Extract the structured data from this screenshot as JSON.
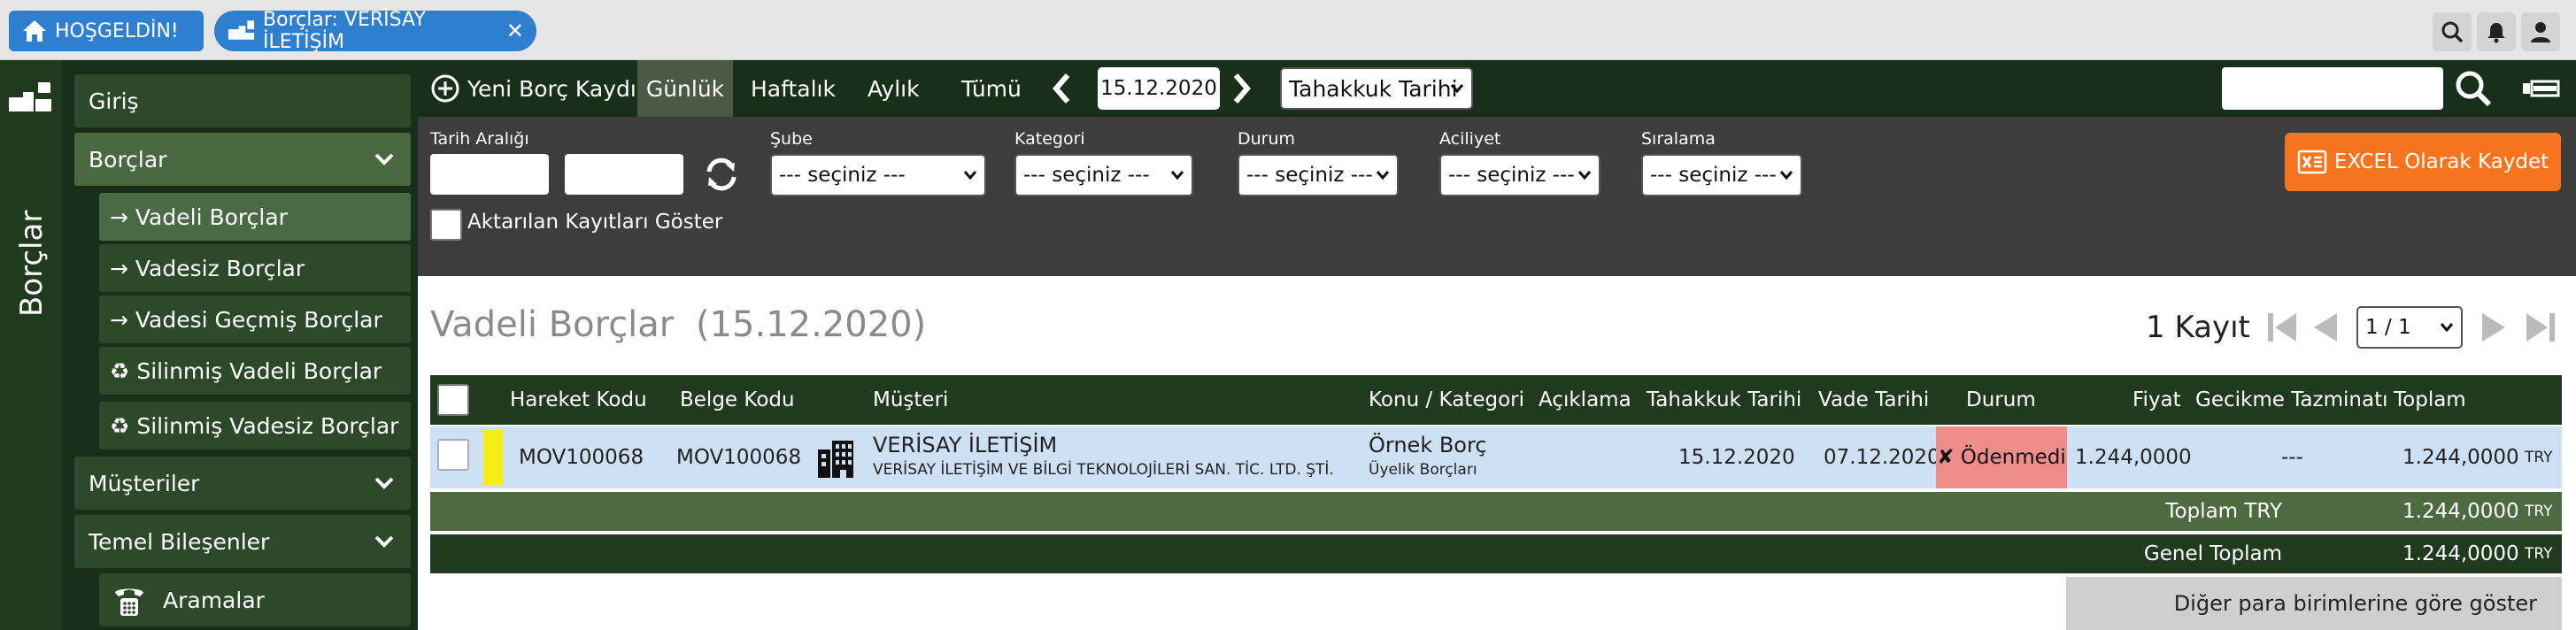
{
  "topbar": {
    "home_tab": "HOŞGELDİN!",
    "active_tab": "Borçlar: VERİSAY İLETİŞİM"
  },
  "rail": {
    "title": "Borçlar"
  },
  "sidebar": {
    "giris": "Giriş",
    "borclar": "Borçlar",
    "vadeli": "→ Vadeli Borçlar",
    "vadesiz": "→ Vadesiz Borçlar",
    "vadesi_gecmis": "→ Vadesi Geçmiş Borçlar",
    "silinmis_vadeli": "♻ Silinmiş Vadeli Borçlar",
    "silinmis_vadesiz": "♻ Silinmiş Vadesiz Borçlar",
    "musteriler": "Müşteriler",
    "temel": "Temel Bileşenler",
    "aramalar": "Aramalar"
  },
  "toolbar": {
    "new_record": "Yeni Borç Kaydı",
    "gunluk": "Günlük",
    "haftalik": "Haftalık",
    "aylik": "Aylık",
    "tumu": "Tümü",
    "date": "15.12.2020",
    "date_type": "Tahakkuk Tarihi"
  },
  "filters": {
    "tarih_araligi": "Tarih Aralığı",
    "sube": "Şube",
    "kategori": "Kategori",
    "durum": "Durum",
    "aciliyet": "Aciliyet",
    "siralama": "Sıralama",
    "placeholder_option": "--- seçiniz ---",
    "aktarilan": "Aktarılan Kayıtları Göster",
    "excel": "EXCEL Olarak Kaydet"
  },
  "content": {
    "title": "Vadeli Borçlar",
    "title_date": "(15.12.2020)",
    "count": "1 Kayıt",
    "page": "1 / 1"
  },
  "table": {
    "headers": {
      "hareket": "Hareket Kodu",
      "belge": "Belge Kodu",
      "musteri": "Müşteri",
      "konu": "Konu / Kategori",
      "aciklama": "Açıklama",
      "tahakkuk": "Tahakkuk Tarihi",
      "vade": "Vade Tarihi",
      "durum": "Durum",
      "fiyat": "Fiyat",
      "gecikme": "Gecikme Tazminatı",
      "toplam": "Toplam"
    },
    "row": {
      "hareket": "MOV100068",
      "belge": "MOV100068",
      "musteri": "VERİSAY İLETİŞİM",
      "musteri_full": "VERİSAY İLETİŞİM VE BİLGİ TEKNOLOJİLERİ SAN. TİC. LTD. ŞTİ.",
      "konu": "Örnek Borç",
      "kategori": "Üyelik Borçları",
      "tahakkuk": "15.12.2020",
      "vade": "07.12.2020",
      "durum": "✘ Ödenmedi",
      "fiyat": "1.244,0000",
      "gecikme": "---",
      "toplam": "1.244,0000",
      "currency": "TRY"
    },
    "sum_try_label": "Toplam TRY",
    "sum_try_value": "1.244,0000",
    "sum_try_currency": "TRY",
    "grand_label": "Genel Toplam",
    "grand_value": "1.244,0000",
    "grand_currency": "TRY",
    "other_currency_btn": "Diğer para birimlerine göre göster"
  },
  "colors": {
    "accent_blue": "#2f7fd1",
    "dark_green": "#18301a",
    "excel_orange": "#f7741f",
    "status_red": "#ef8d8a"
  }
}
